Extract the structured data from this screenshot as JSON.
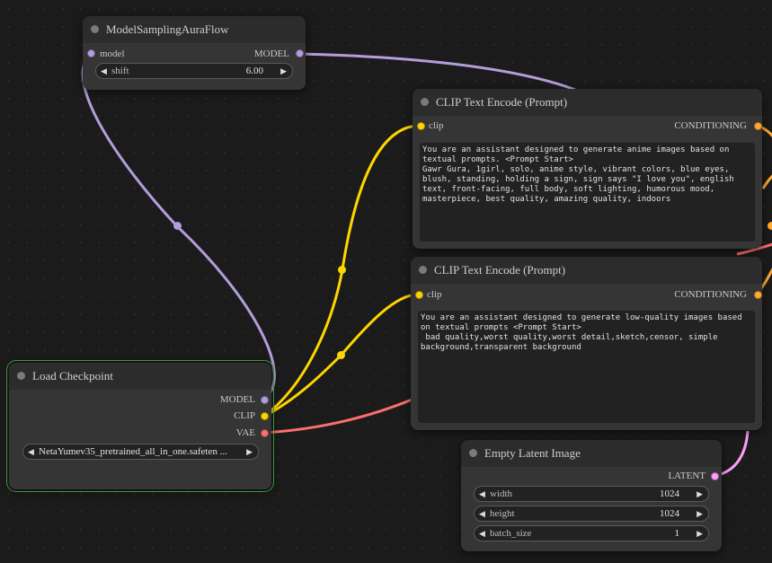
{
  "colors": {
    "model": "#b39ddb",
    "clip": "#ffd500",
    "vae": "#ff6e6e",
    "conditioning": "#ffa931",
    "latent": "#ff9cf9",
    "selected_outline": "#3b9a3b"
  },
  "nodes": {
    "model_sampling": {
      "title": "ModelSamplingAuraFlow",
      "input_model": "model",
      "output_model": "MODEL",
      "shift_label": "shift",
      "shift_value": "6.00"
    },
    "clip_positive": {
      "title": "CLIP Text Encode (Prompt)",
      "input_clip": "clip",
      "output_conditioning": "CONDITIONING",
      "text": "You are an assistant designed to generate anime images based on textual prompts. <Prompt Start>\nGawr Gura, 1girl, solo, anime style, vibrant colors, blue eyes, blush, standing, holding a sign, sign says \"I love you\", english text, front-facing, full body, soft lighting, humorous mood, masterpiece, best quality, amazing quality, indoors"
    },
    "clip_negative": {
      "title": "CLIP Text Encode (Prompt)",
      "input_clip": "clip",
      "output_conditioning": "CONDITIONING",
      "text": "You are an assistant designed to generate low-quality images based on textual prompts <Prompt Start>\n bad quality,worst quality,worst detail,sketch,censor, simple background,transparent background"
    },
    "load_checkpoint": {
      "title": "Load Checkpoint",
      "output_model": "MODEL",
      "output_clip": "CLIP",
      "output_vae": "VAE",
      "ckpt_value": "NetaYumev35_pretrained_all_in_one.safeten ..."
    },
    "empty_latent": {
      "title": "Empty Latent Image",
      "output_latent": "LATENT",
      "width_label": "width",
      "width_value": "1024",
      "height_label": "height",
      "height_value": "1024",
      "batch_label": "batch_size",
      "batch_value": "1"
    }
  },
  "icons": {
    "widget_left": "◀",
    "widget_right": "▶"
  }
}
